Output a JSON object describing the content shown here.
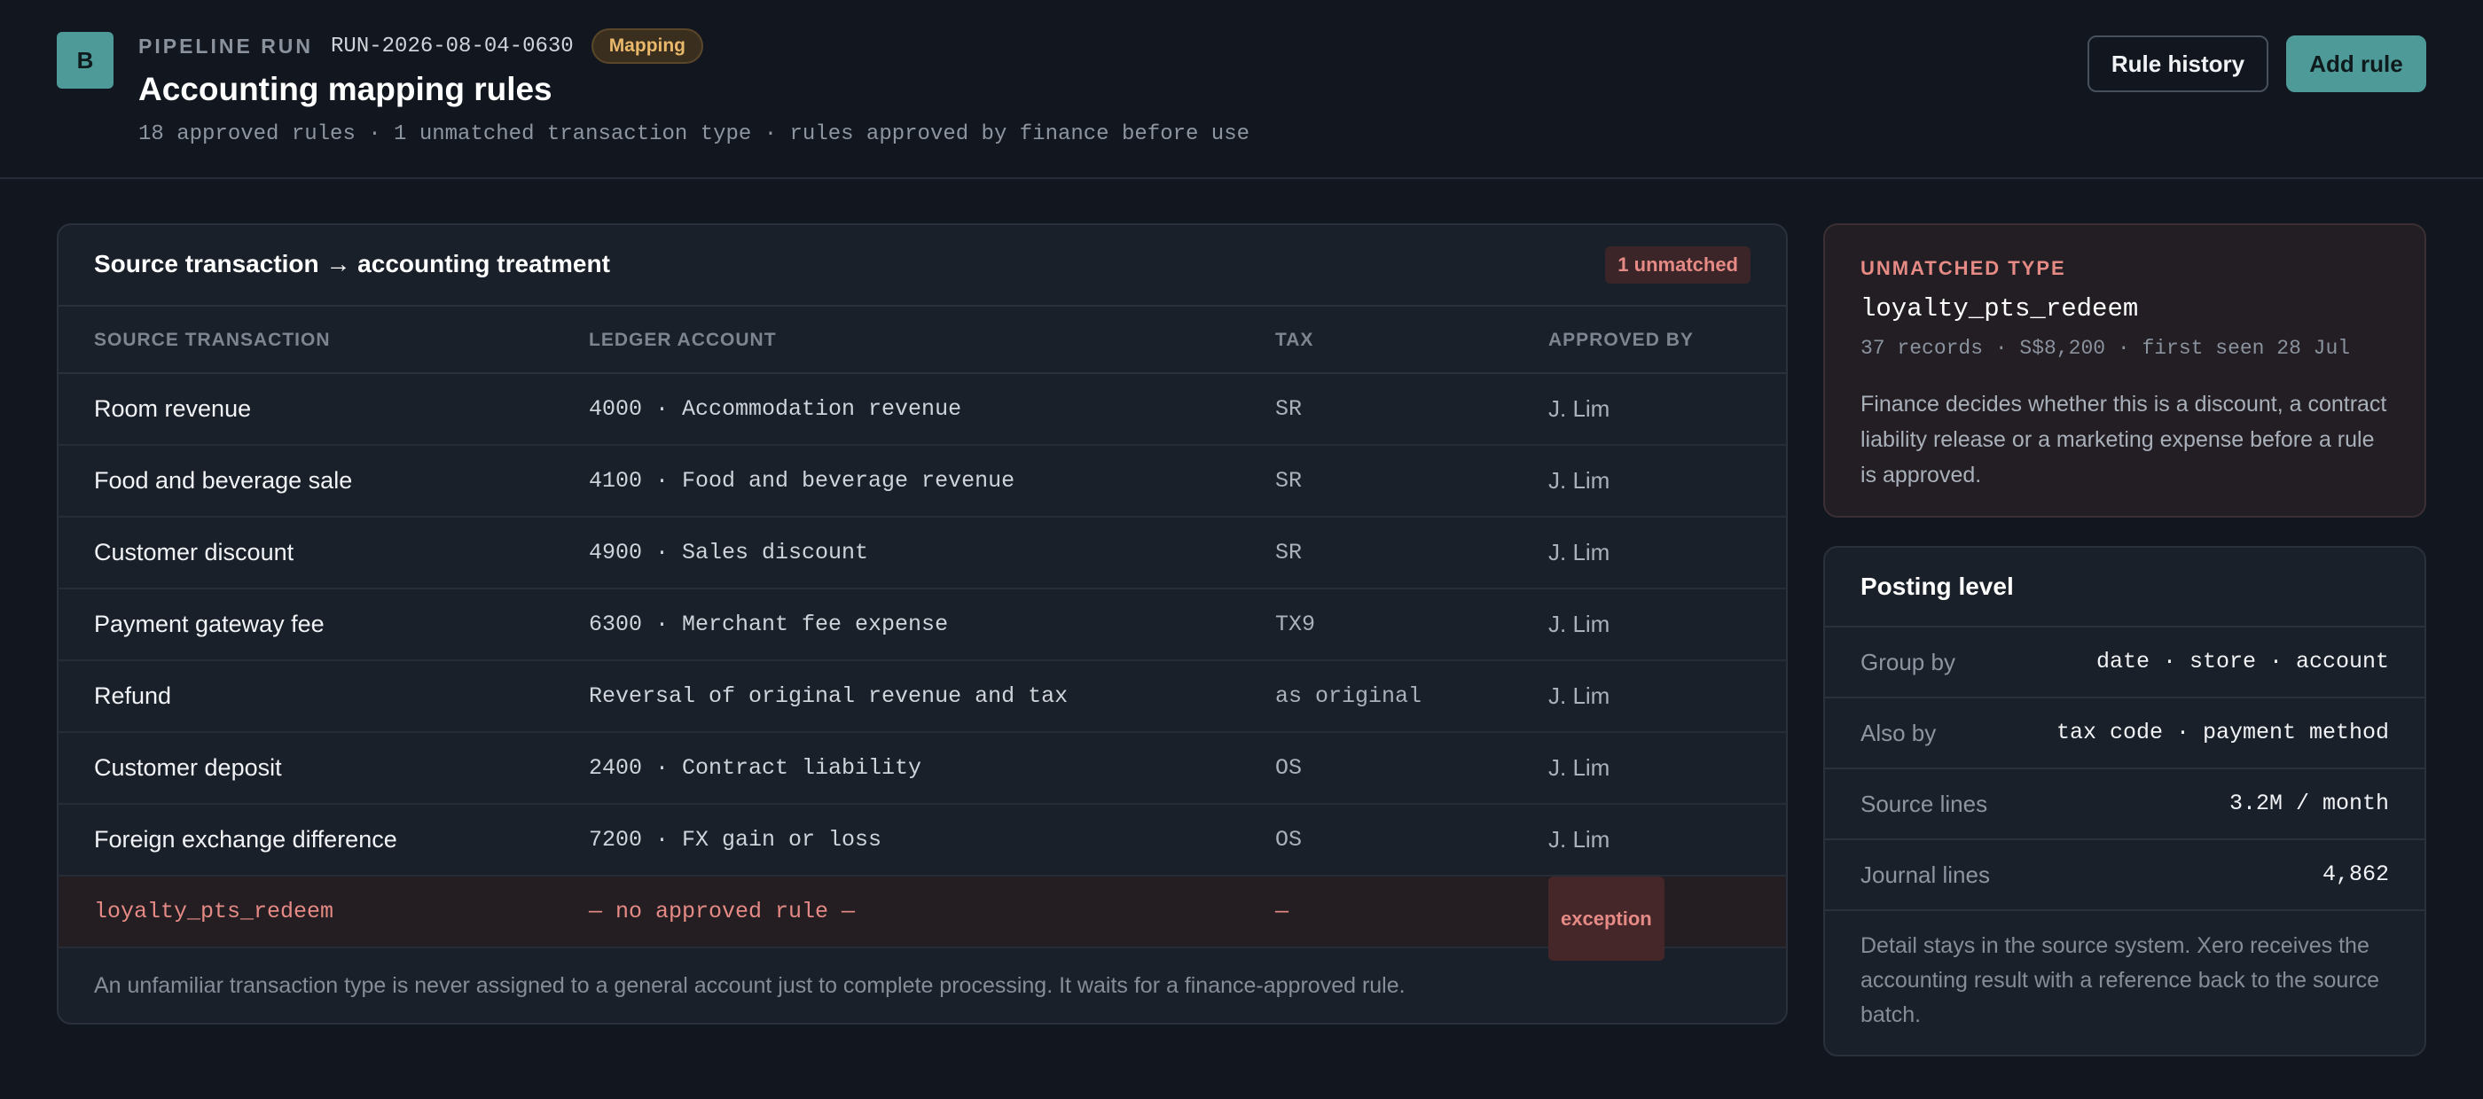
{
  "header": {
    "logo_letter": "B",
    "eyebrow": "PIPELINE RUN",
    "run_id": "RUN-2026-08-04-0630",
    "status_badge": "Mapping",
    "title": "Accounting mapping rules",
    "subtitle": "18 approved rules · 1 unmatched transaction type · rules approved by finance before use",
    "rule_history_label": "Rule history",
    "add_rule_label": "Add rule"
  },
  "table": {
    "title": "Source transaction → accounting treatment",
    "unmatched_badge": "1 unmatched",
    "columns": [
      "SOURCE TRANSACTION",
      "LEDGER ACCOUNT",
      "TAX",
      "APPROVED BY"
    ],
    "rows": [
      {
        "source": "Room revenue",
        "account": "4000 · Accommodation revenue",
        "tax": "SR",
        "approved_by": "J. Lim"
      },
      {
        "source": "Food and beverage sale",
        "account": "4100 · Food and beverage revenue",
        "tax": "SR",
        "approved_by": "J. Lim"
      },
      {
        "source": "Customer discount",
        "account": "4900 · Sales discount",
        "tax": "SR",
        "approved_by": "J. Lim"
      },
      {
        "source": "Payment gateway fee",
        "account": "6300 · Merchant fee expense",
        "tax": "TX9",
        "approved_by": "J. Lim"
      },
      {
        "source": "Refund",
        "account": "Reversal of original revenue and tax",
        "tax": "as original",
        "approved_by": "J. Lim"
      },
      {
        "source": "Customer deposit",
        "account": "2400 · Contract liability",
        "tax": "OS",
        "approved_by": "J. Lim"
      },
      {
        "source": "Foreign exchange difference",
        "account": "7200 · FX gain or loss",
        "tax": "OS",
        "approved_by": "J. Lim"
      }
    ],
    "exception_row": {
      "source": "loyalty_pts_redeem",
      "account": "— no approved rule —",
      "tax": "—",
      "status": "exception"
    },
    "note": "An unfamiliar transaction type is never assigned to a general account just to complete processing. It waits for a finance-approved rule."
  },
  "unmatched": {
    "label": "UNMATCHED TYPE",
    "name": "loyalty_pts_redeem",
    "stats": "37 records · S$8,200 · first seen 28 Jul",
    "description": "Finance decides whether this is a discount, a contract liability release or a marketing expense before a rule is approved."
  },
  "posting_level": {
    "title": "Posting level",
    "rows": [
      {
        "key": "Group by",
        "value": "date · store · account"
      },
      {
        "key": "Also by",
        "value": "tax code · payment method"
      },
      {
        "key": "Source lines",
        "value": "3.2M / month"
      },
      {
        "key": "Journal lines",
        "value": "4,862"
      }
    ],
    "note": "Detail stays in the source system. Xero receives the accounting result with a reference back to the source batch."
  },
  "colors": {
    "accent": "#4d9a98",
    "background": "#12171f",
    "card": "#1a2029",
    "warning": "#e9b86a",
    "danger": "#e58a84"
  }
}
